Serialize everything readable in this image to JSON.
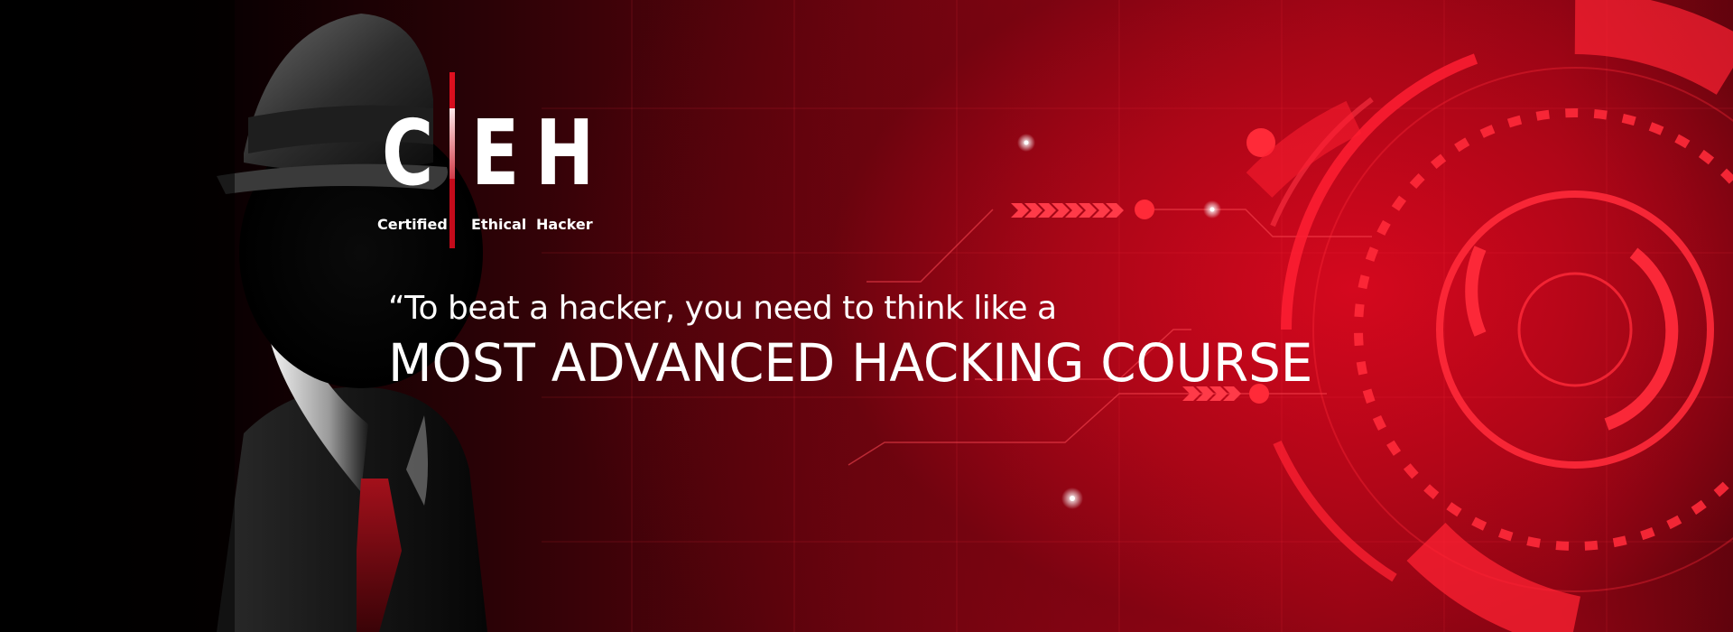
{
  "logo": {
    "letter_c": "C",
    "letter_e": "E",
    "letter_h": "H",
    "word_1": "Certified",
    "word_2": "Ethical",
    "word_3": "Hacker"
  },
  "quote": "“To beat a hacker, you need to think like a",
  "headline": "MOST ADVANCED HACKING COURSE",
  "colors": {
    "accent_red": "#e0101f",
    "text": "#ffffff",
    "background_dark": "#000000"
  },
  "icons": [
    "hacker-figure-illustration",
    "target-reticle-graphic",
    "chevron-arrows-icon"
  ]
}
